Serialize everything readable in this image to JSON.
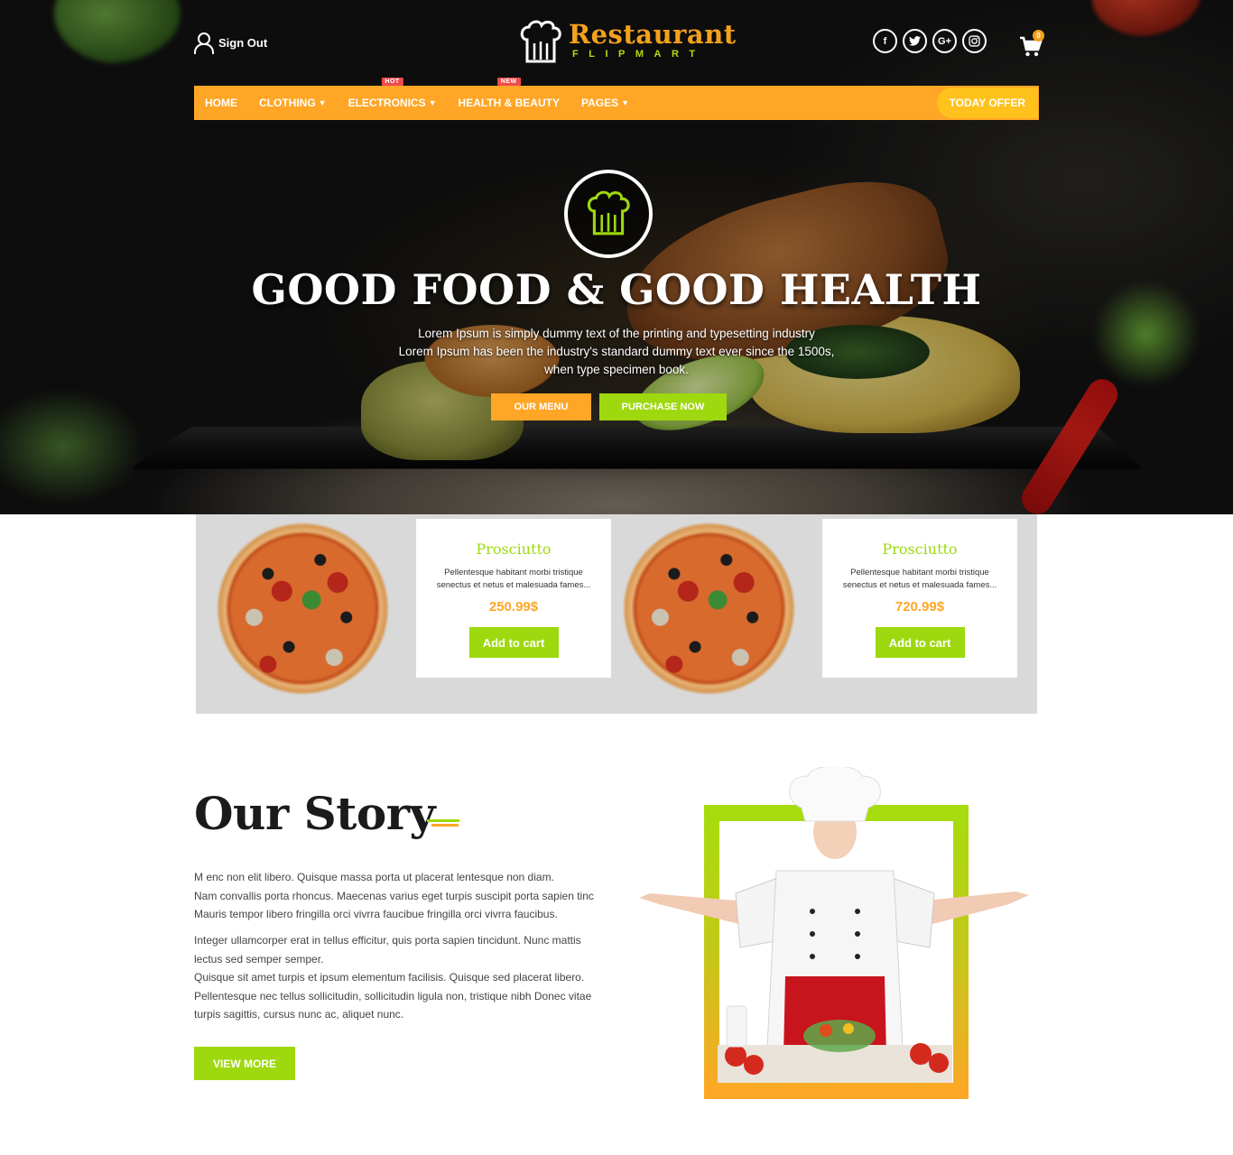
{
  "header": {
    "sign_out": "Sign Out",
    "logo_title": "Restaurant",
    "logo_sub": "FLIPMART",
    "socials": [
      "f",
      "t",
      "G+",
      "ig"
    ],
    "cart_count": "0"
  },
  "nav": {
    "items": [
      {
        "label": "HOME"
      },
      {
        "label": "CLOTHING"
      },
      {
        "label": "ELECTRONICS",
        "tag": "HOT"
      },
      {
        "label": "HEALTH & BEAUTY",
        "tag": "NEW"
      },
      {
        "label": "PAGES"
      }
    ],
    "today_offer": "TODAY OFFER"
  },
  "hero": {
    "title": "GOOD FOOD & GOOD HEALTH",
    "sub": [
      "Lorem Ipsum is simply dummy text of the printing and typesetting industry",
      "Lorem Ipsum has been the industry's standard dummy text ever since the 1500s,",
      "when type specimen book."
    ],
    "btn_menu": "OUR MENU",
    "btn_buy": "PURCHASE NOW"
  },
  "products": [
    {
      "title": "Prosciutto",
      "desc": "Pellentesque habitant morbi tristique senectus et netus et malesuada fames...",
      "price": "250.99$",
      "button": "Add to cart"
    },
    {
      "title": "Prosciutto",
      "desc": "Pellentesque habitant morbi tristique senectus et netus et malesuada fames...",
      "price": "720.99$",
      "button": "Add to cart"
    }
  ],
  "story": {
    "title": "Our Story",
    "p1": [
      "M enc non elit libero. Quisque massa porta ut placerat lentesque non diam.",
      "Nam convallis porta rhoncus. Maecenas varius eget turpis suscipit porta sapien tinc",
      "Mauris tempor libero fringilla orci vivrra faucibue fringilla orci vivrra faucibus."
    ],
    "p2": [
      "Integer ullamcorper erat in tellus efficitur, quis porta sapien tincidunt. Nunc mattis",
      "lectus sed semper semper.",
      "Quisque sit amet turpis et ipsum elementum facilisis. Quisque sed placerat libero.",
      "Pellentesque nec tellus sollicitudin, sollicitudin ligula non, tristique nibh Donec vitae",
      "turpis sagittis, cursus nunc ac, aliquet nunc."
    ],
    "button": "VIEW MORE"
  },
  "colors": {
    "orange": "#ffa626",
    "green": "#9ed80e",
    "yellow": "#ffc21c",
    "tag_red": "#ef4b4b"
  }
}
